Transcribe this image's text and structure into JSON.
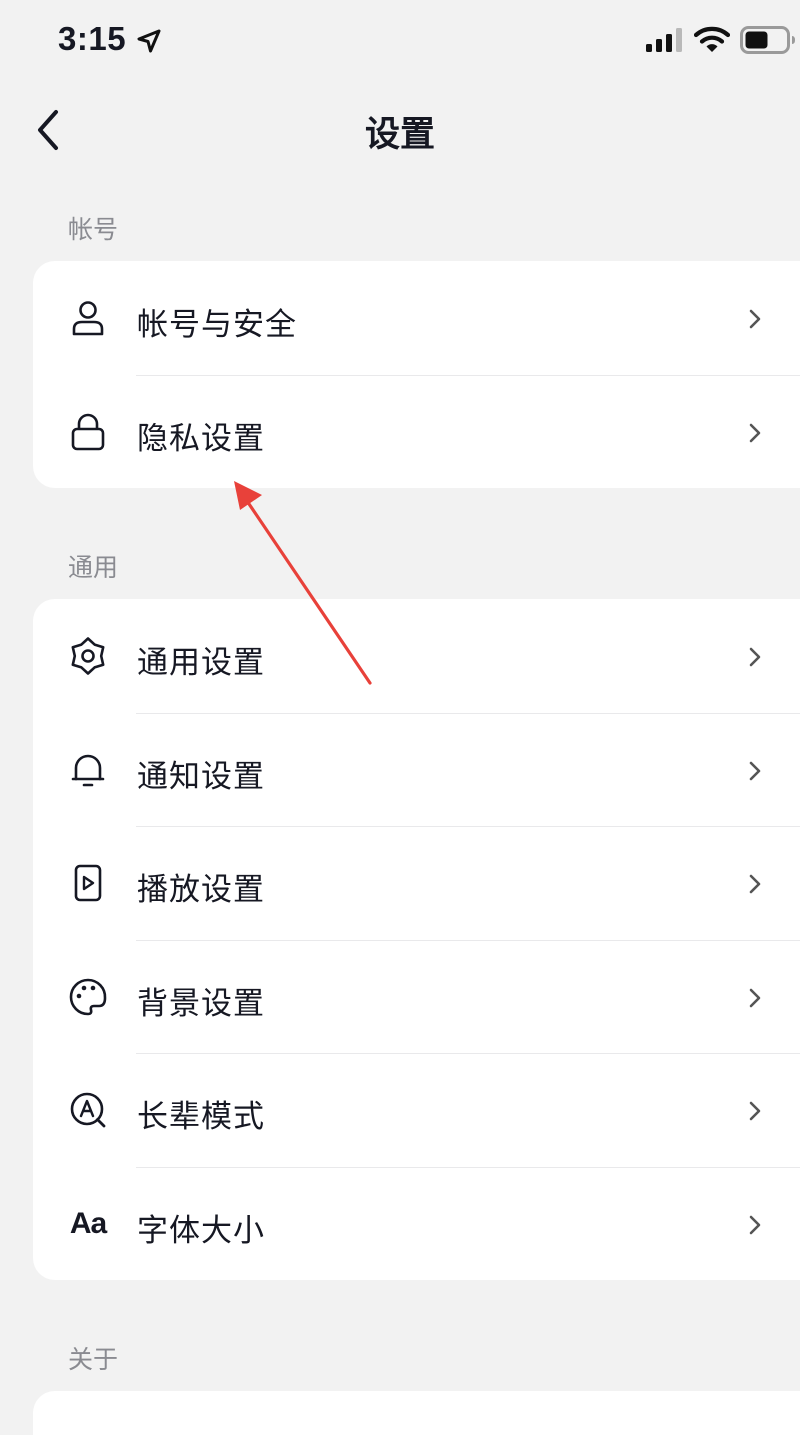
{
  "status_bar": {
    "time": "3:15"
  },
  "nav": {
    "title": "设置"
  },
  "sections": {
    "account": {
      "header": "帐号",
      "items": [
        {
          "label": "帐号与安全",
          "icon": "user-icon"
        },
        {
          "label": "隐私设置",
          "icon": "lock-icon"
        }
      ]
    },
    "general": {
      "header": "通用",
      "items": [
        {
          "label": "通用设置",
          "icon": "gear-icon"
        },
        {
          "label": "通知设置",
          "icon": "bell-icon"
        },
        {
          "label": "播放设置",
          "icon": "play-icon"
        },
        {
          "label": "背景设置",
          "icon": "palette-icon"
        },
        {
          "label": "长辈模式",
          "icon": "elder-mode-icon"
        },
        {
          "label": "字体大小",
          "icon": "font-size-icon",
          "icon_text": "Aa"
        }
      ]
    },
    "about": {
      "header": "关于"
    }
  },
  "colors": {
    "background": "#f2f2f2",
    "card": "#ffffff",
    "text": "#161823",
    "section_header": "#8a8b91",
    "annotation_arrow": "#e8413a"
  }
}
